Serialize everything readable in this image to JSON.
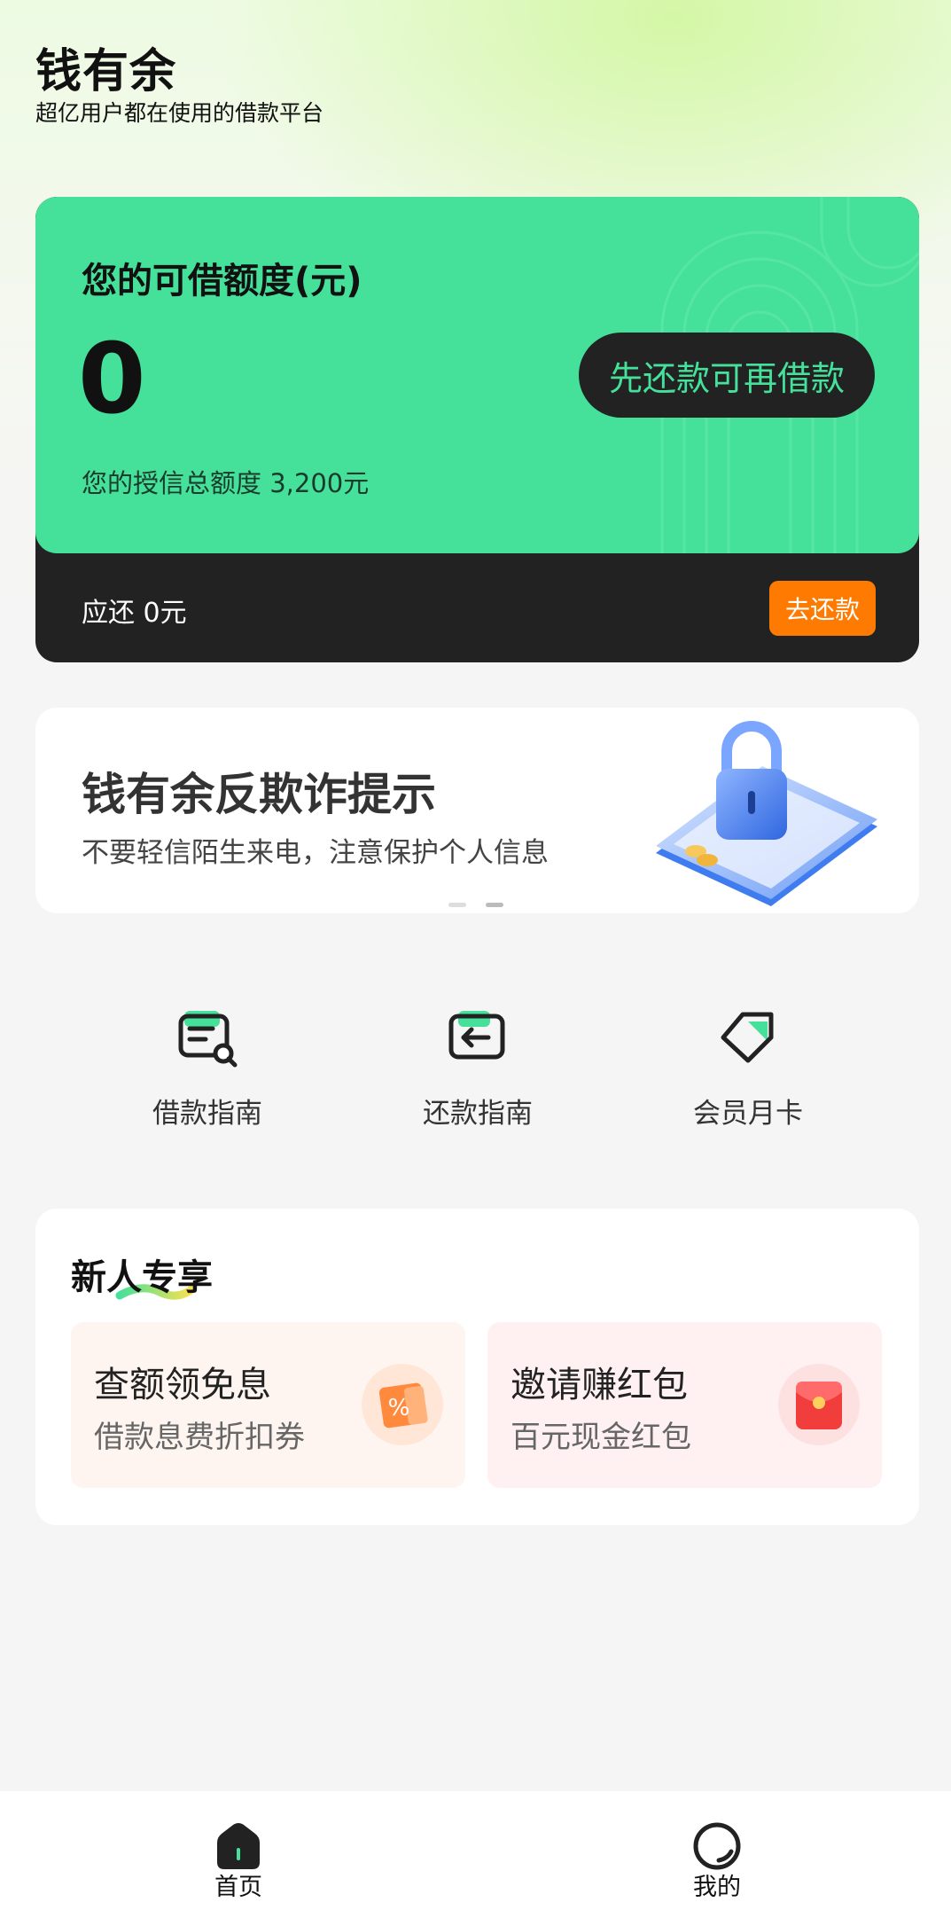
{
  "header": {
    "app_title": "钱有余",
    "subtitle": "超亿用户都在使用的借款平台"
  },
  "credit_card": {
    "label": "您的可借额度(元)",
    "amount": "0",
    "reborrow_button": "先还款可再借款",
    "total_credit": "您的授信总额度 3,200元",
    "due_text": "应还 0元",
    "repay_button": "去还款",
    "accent_color": "#45e19a",
    "dark_color": "#222223",
    "repay_color": "#ff7a00"
  },
  "banner": {
    "title": "钱有余反欺诈提示",
    "subtitle": "不要轻信陌生来电，注意保护个人信息",
    "icon": "lock-phone-illustration",
    "page_count": 2,
    "active_page": 2
  },
  "quick_actions": [
    {
      "label": "借款指南",
      "icon": "document-search-icon"
    },
    {
      "label": "还款指南",
      "icon": "repay-arrow-icon"
    },
    {
      "label": "会员月卡",
      "icon": "tag-icon"
    }
  ],
  "newbie": {
    "title": "新人专享",
    "promos": [
      {
        "title": "查额领免息",
        "subtitle": "借款息费折扣券",
        "icon": "coupon-percent-icon"
      },
      {
        "title": "邀请赚红包",
        "subtitle": "百元现金红包",
        "icon": "red-envelope-icon"
      }
    ]
  },
  "tabbar": {
    "tabs": [
      {
        "label": "首页",
        "icon": "home-icon",
        "active": true
      },
      {
        "label": "我的",
        "icon": "profile-icon",
        "active": false
      }
    ]
  }
}
